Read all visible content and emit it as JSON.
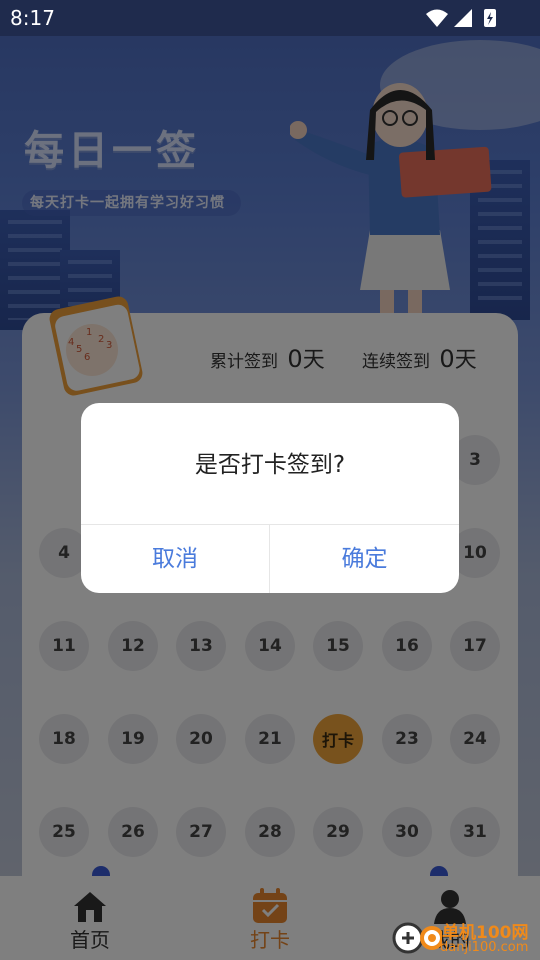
{
  "status_bar": {
    "time": "8:17"
  },
  "hero": {
    "title": "每日一签",
    "subtitle": "每天打卡一起拥有学习好习惯"
  },
  "stats": {
    "total_label": "累计签到",
    "total_value": "0",
    "total_unit": "天",
    "streak_label": "连续签到",
    "streak_value": "0",
    "streak_unit": "天"
  },
  "calendar": {
    "visible_days": [
      "3",
      "4",
      "10",
      "11",
      "12",
      "13",
      "14",
      "15",
      "16",
      "17",
      "18",
      "19",
      "20",
      "21",
      "打卡",
      "23",
      "24",
      "25",
      "26",
      "27",
      "28",
      "29",
      "30",
      "31"
    ],
    "checkin_label": "打卡",
    "icon_numbers": [
      "1",
      "2",
      "3",
      "4",
      "5",
      "6"
    ]
  },
  "dialog": {
    "message": "是否打卡签到?",
    "cancel": "取消",
    "confirm": "确定"
  },
  "bottom_nav": {
    "items": [
      {
        "label": "首页"
      },
      {
        "label": "打卡"
      },
      {
        "label": "我的"
      }
    ]
  },
  "watermark": {
    "line1": "单机100网",
    "line2": "danji100.com"
  },
  "colors": {
    "accent": "#f0a43a",
    "dialog_button": "#4a7bdc",
    "nav_active": "#e8862e"
  }
}
